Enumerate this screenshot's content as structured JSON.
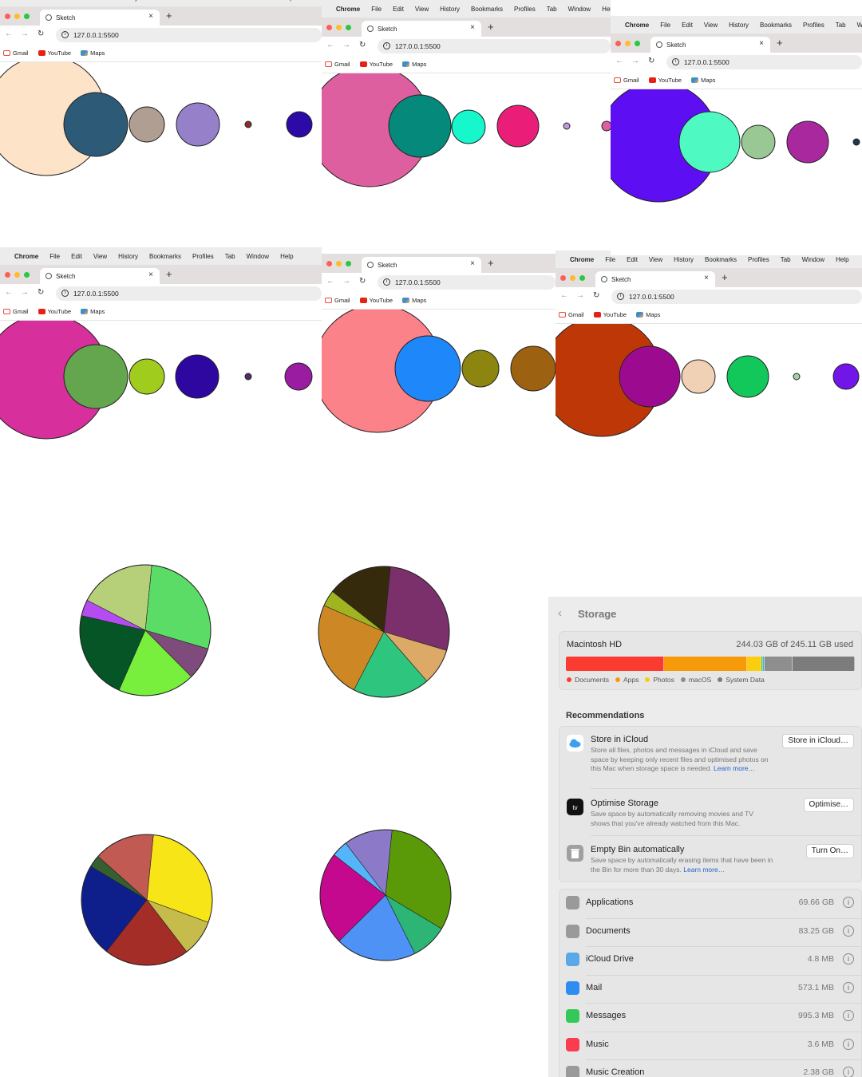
{
  "browser": {
    "menu": {
      "apple": "",
      "app": "Chrome",
      "items": [
        "File",
        "Edit",
        "View",
        "History",
        "Bookmarks",
        "Profiles",
        "Tab",
        "Window",
        "Help"
      ]
    },
    "tab_title": "Sketch",
    "tab_close": "×",
    "new_tab": "+",
    "url": "127.0.0.1:5500",
    "bookmarks": [
      "Gmail",
      "YouTube",
      "Maps"
    ],
    "nav": {
      "back": "←",
      "forward": "→",
      "reload": "↻"
    },
    "info_glyph": "i"
  },
  "screenshots": [
    {
      "circles": [
        {
          "color": "#fde3c8"
        },
        {
          "color": "#2c5a77"
        },
        {
          "color": "#b09e93"
        },
        {
          "color": "#9580c9"
        },
        {
          "color": "#8b2e2e"
        },
        {
          "color": "#2c0aa8"
        }
      ]
    },
    {
      "circles": [
        {
          "color": "#dd5fa0"
        },
        {
          "color": "#04897a"
        },
        {
          "color": "#16f7cc"
        },
        {
          "color": "#ea1e78"
        },
        {
          "color": "#c39ad9"
        },
        {
          "color": "#dd5fa0"
        }
      ]
    },
    {
      "circles": [
        {
          "color": "#5e0ef2"
        },
        {
          "color": "#4ef9c2"
        },
        {
          "color": "#99c894"
        },
        {
          "color": "#a9289d"
        },
        {
          "color": "#1e3a4f"
        }
      ]
    },
    {
      "circles": [
        {
          "color": "#d72f9b"
        },
        {
          "color": "#63a64d"
        },
        {
          "color": "#a0cc1e"
        },
        {
          "color": "#2e07a0"
        },
        {
          "color": "#532d63"
        },
        {
          "color": "#9a1ca0"
        }
      ]
    },
    {
      "circles": [
        {
          "color": "#fa8288"
        },
        {
          "color": "#1e88fa"
        },
        {
          "color": "#8c850f"
        },
        {
          "color": "#9c6111"
        }
      ]
    },
    {
      "circles": [
        {
          "color": "#bd3806"
        },
        {
          "color": "#9b0a8f"
        },
        {
          "color": "#f0d1b6"
        },
        {
          "color": "#12c85a"
        },
        {
          "color": "#a3d1a3"
        },
        {
          "color": "#7215e8"
        }
      ]
    }
  ],
  "pie_charts": [
    {
      "slices": [
        {
          "color": "#5adc66",
          "value": 28
        },
        {
          "color": "#7f4a7c",
          "value": 8
        },
        {
          "color": "#78ee3d",
          "value": 19
        },
        {
          "color": "#065526",
          "value": 22
        },
        {
          "color": "#b44cf1",
          "value": 4
        },
        {
          "color": "#b6d07a",
          "value": 19
        }
      ]
    },
    {
      "slices": [
        {
          "color": "#7b306b",
          "value": 28
        },
        {
          "color": "#dda966",
          "value": 9
        },
        {
          "color": "#2ec67e",
          "value": 19
        },
        {
          "color": "#cd8825",
          "value": 24
        },
        {
          "color": "#9fb41e",
          "value": 4
        },
        {
          "color": "#352a0c",
          "value": 16
        }
      ]
    },
    {
      "slices": [
        {
          "color": "#f7e517",
          "value": 29
        },
        {
          "color": "#c6bc4c",
          "value": 9
        },
        {
          "color": "#a52d27",
          "value": 21
        },
        {
          "color": "#0e1f8c",
          "value": 23
        },
        {
          "color": "#355f31",
          "value": 3
        },
        {
          "color": "#c15a52",
          "value": 15
        }
      ]
    },
    {
      "slices": [
        {
          "color": "#5a9a08",
          "value": 32
        },
        {
          "color": "#2db576",
          "value": 9
        },
        {
          "color": "#4f92f6",
          "value": 20
        },
        {
          "color": "#c5098f",
          "value": 23
        },
        {
          "color": "#54b5fb",
          "value": 4
        },
        {
          "color": "#8c79c7",
          "value": 12
        }
      ]
    }
  ],
  "storage": {
    "title": "Storage",
    "back": "‹",
    "disk": {
      "name": "Macintosh HD",
      "used_label": "244.03 GB of 245.11 GB used"
    },
    "bar": [
      {
        "label": "Documents",
        "color": "#fb3b30",
        "value": 34
      },
      {
        "label": "Apps",
        "color": "#f79a0a",
        "value": 28.5
      },
      {
        "label": "Photos",
        "color": "#fbcd0c",
        "value": 5
      },
      {
        "label": "",
        "color": "#30c25a",
        "value": 0.6
      },
      {
        "label": "",
        "color": "#5aa8d8",
        "value": 0.6
      },
      {
        "label": "macOS",
        "color": "#8e8e8e",
        "value": 9.5
      },
      {
        "label": "System Data",
        "color": "#7c7c7c",
        "value": 21.5
      }
    ],
    "legend": [
      {
        "label": "Documents",
        "color": "#fb3b30"
      },
      {
        "label": "Apps",
        "color": "#f79a0a"
      },
      {
        "label": "Photos",
        "color": "#fbcd0c"
      },
      {
        "label": "macOS",
        "color": "#8e8e8e"
      },
      {
        "label": "System Data",
        "color": "#7c7c7c"
      }
    ],
    "recommendations_title": "Recommendations",
    "recommendations": [
      {
        "icon": "icloud-icon",
        "title": "Store in iCloud",
        "desc": "Store all files, photos and messages in iCloud and save space by keeping only recent files and optimised photos on this Mac when storage space is needed.",
        "link": "Learn more…",
        "button": "Store in iCloud…"
      },
      {
        "icon": "apple-tv-icon",
        "title": "Optimise Storage",
        "desc": "Save space by automatically removing movies and TV shows that you've already watched from this Mac.",
        "link": "",
        "button": "Optimise…"
      },
      {
        "icon": "trash-icon",
        "title": "Empty Bin automatically",
        "desc": "Save space by automatically erasing items that have been in the Bin for more than 30 days.",
        "link": "Learn more…",
        "button": "Turn On…"
      }
    ],
    "categories": [
      {
        "name": "Applications",
        "size": "69.66 GB",
        "icon": "applications-icon",
        "color": "#9a9a9a"
      },
      {
        "name": "Documents",
        "size": "83.25 GB",
        "icon": "documents-icon",
        "color": "#9a9a9a"
      },
      {
        "name": "iCloud Drive",
        "size": "4.8 MB",
        "icon": "icloud-drive-icon",
        "color": "#5aa8e8"
      },
      {
        "name": "Mail",
        "size": "573.1 MB",
        "icon": "mail-icon",
        "color": "#2f8cf0"
      },
      {
        "name": "Messages",
        "size": "995.3 MB",
        "icon": "messages-icon",
        "color": "#34c759"
      },
      {
        "name": "Music",
        "size": "3.6 MB",
        "icon": "music-icon",
        "color": "#fb3b4f"
      },
      {
        "name": "Music Creation",
        "size": "2.38 GB",
        "icon": "music-creation-icon",
        "color": "#9a9a9a"
      }
    ]
  }
}
